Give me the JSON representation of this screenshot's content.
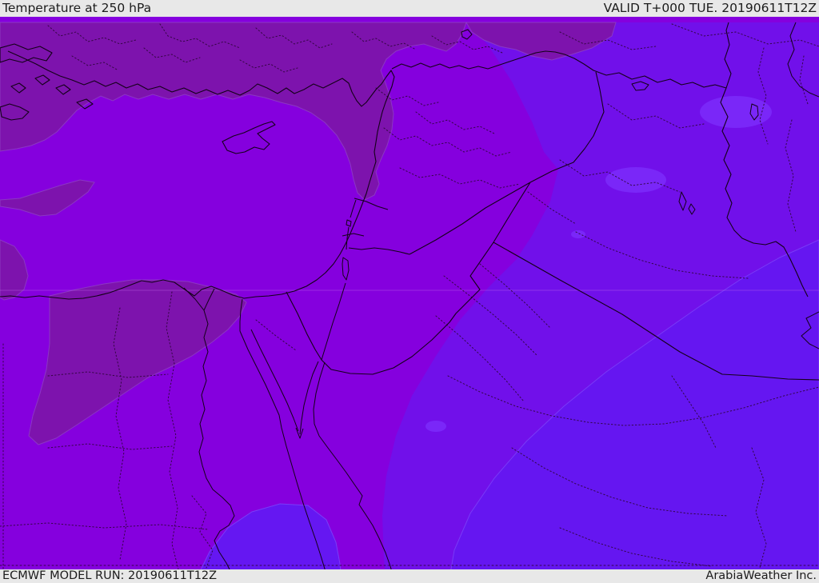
{
  "header": {
    "title": "Temperature at 250 hPa",
    "valid_label": "VALID T+000 TUE. 20190611T12Z"
  },
  "footer": {
    "model_run": "ECMWF MODEL RUN: 20190611T12Z",
    "branding": "ArabiaWeather Inc."
  },
  "map": {
    "colors": {
      "bar_bg": "#e8e8e8",
      "bar_text": "#1c1c1c",
      "band_base": "#8500de",
      "band_dark": "#7d13ad",
      "band_dark_edge": "#9148c4",
      "band_indigo": "#7110ea",
      "band_violet": "#6517f2",
      "band_violet_edge": "#7a3cf8",
      "band_light": "#7b2bfa",
      "border_line": "#140018",
      "admin_line": "#2e0638",
      "graticule": "#c471e8"
    }
  }
}
